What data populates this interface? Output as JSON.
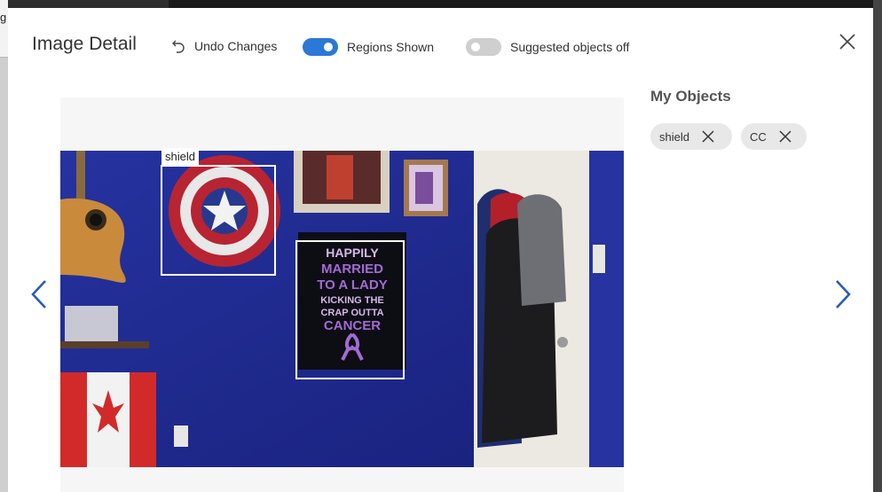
{
  "header": {
    "title": "Image Detail",
    "undo_label": "Undo Changes",
    "regions_label": "Regions Shown",
    "suggested_label": "Suggested objects off"
  },
  "toggles": {
    "regions_shown": true,
    "suggested_objects": false
  },
  "regions": [
    {
      "label": "shield"
    }
  ],
  "side": {
    "title": "My Objects",
    "objects": [
      "shield",
      "CC"
    ]
  },
  "background": {
    "left_edge_text": "g"
  },
  "colors": {
    "accent": "#2b78d6",
    "toggle_off": "#cfcfcf",
    "chip_bg": "#e8e8e8",
    "wall": "#1d2a8a"
  }
}
